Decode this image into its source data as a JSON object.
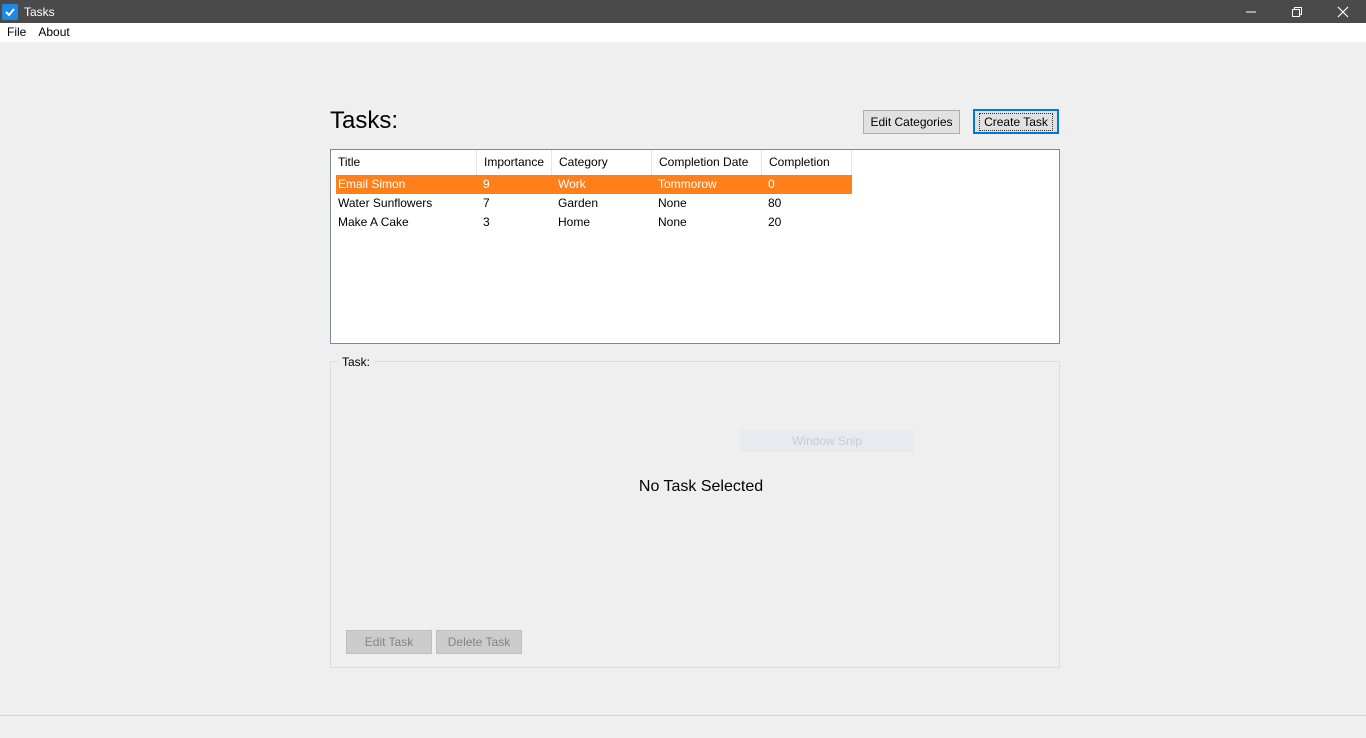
{
  "window": {
    "title": "Tasks"
  },
  "menu": {
    "items": [
      "File",
      "About"
    ]
  },
  "main": {
    "heading": "Tasks:",
    "edit_categories_label": "Edit Categories",
    "create_task_label": "Create Task"
  },
  "table": {
    "columns": [
      "Title",
      "Importance",
      "Category",
      "Completion Date",
      "Completion"
    ],
    "rows": [
      [
        "Email Simon",
        "9",
        "Work",
        "Tommorow",
        "0"
      ],
      [
        "Water Sunflowers",
        "7",
        "Garden",
        "None",
        "80"
      ],
      [
        "Make A Cake",
        "3",
        "Home",
        "None",
        "20"
      ]
    ],
    "selected_row": 0,
    "selection_color": "#ff7f1a"
  },
  "task_panel": {
    "label": "Task:",
    "overlay_text": "Window Snip",
    "empty_message": "No Task Selected",
    "edit_label": "Edit Task",
    "delete_label": "Delete Task"
  }
}
